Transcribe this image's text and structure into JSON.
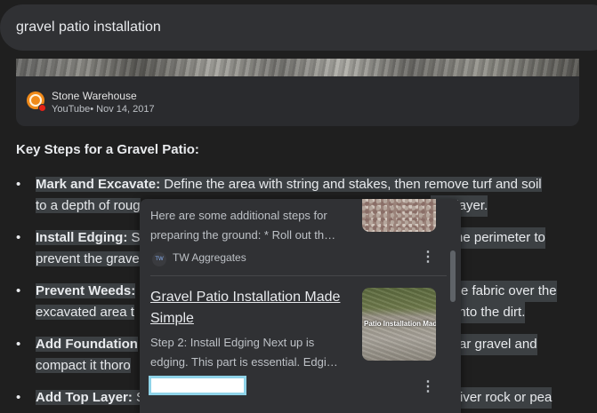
{
  "search": {
    "query": "gravel patio installation"
  },
  "video": {
    "channel": "Stone Warehouse",
    "meta": "YouTube• Nov 14, 2017",
    "logo_color": "#f08a1a",
    "badge_color": "#e62117"
  },
  "heading": "Key Steps for a Gravel Patio:",
  "steps": [
    {
      "label": "Mark and Excavate:",
      "line1": " Define the area with string and stakes, then remove turf and soil",
      "line2_start": "to a depth of roug",
      "line2_end": "ase layer."
    },
    {
      "label": "Install Edging:",
      "line1_start": " S",
      "line1_end": "he perimeter to",
      "line2_start": "prevent the grave",
      "line2_end": ""
    },
    {
      "label": "Prevent Weeds:",
      "line1_end": "e fabric over the",
      "line2_start": "excavated area t",
      "line2_end": "into the dirt."
    },
    {
      "label": "Add Foundation",
      "line1_end": "gular gravel and",
      "line2_start": "compact it thoro",
      "line2_end": ""
    },
    {
      "label": "Add Top Layer:",
      "line1_start": " S",
      "line1_end": "river rock or pea"
    }
  ],
  "popup": {
    "result1": {
      "snippet_line1": "Here are some additional steps for",
      "snippet_line2": "preparing the ground: * Roll out th…",
      "source": "TW Aggregates",
      "source_logo": "TW"
    },
    "result2": {
      "title_line1": "Gravel Patio Installation Made",
      "title_line2": "Simple",
      "snippet_line1": "Step 2: Install Edging Next up is",
      "snippet_line2": "edging. This part is essential. Edgi…",
      "thumb_caption": "Patio Installation Made"
    },
    "more_icon": "⋮"
  }
}
